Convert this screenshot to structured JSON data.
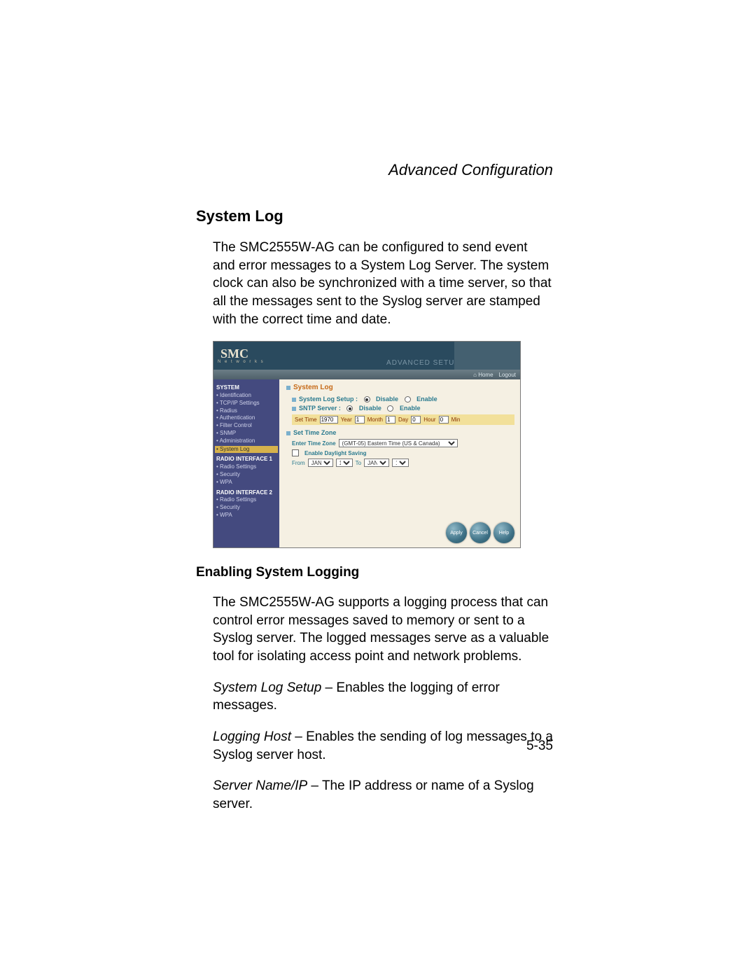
{
  "chapter_title": "Advanced Configuration",
  "section_title": "System Log",
  "intro_text": "The SMC2555W-AG can be configured to send event and error messages to a System Log Server. The system clock can also be synchronized with a time server, so that all the messages sent to the Syslog server are stamped with the correct time and date.",
  "subheading": "Enabling System Logging",
  "para1": "The SMC2555W-AG supports a logging process that can control error messages saved to memory or sent to a Syslog server. The logged messages serve as a valuable tool for isolating access point and network problems.",
  "def1_term": "System Log Setup",
  "def1_body": " – Enables the logging of error messages.",
  "def2_term": "Logging Host",
  "def2_body": " – Enables the sending of log messages to a Syslog server host.",
  "def3_term": "Server Name/IP",
  "def3_body": " – The IP address or name of a Syslog server.",
  "page_number": "5-35",
  "router": {
    "logo": "SMC",
    "logo_sub": "N e t w o r k s",
    "header_caption": "ADVANCED SETUP",
    "topbar": {
      "home": "Home",
      "logout": "Logout",
      "home_icon": "⌂"
    },
    "nav": {
      "grp_system": "SYSTEM",
      "identification": "Identification",
      "tcpip": "TCP/IP Settings",
      "radius": "Radius",
      "auth": "Authentication",
      "filter": "Filter Control",
      "snmp": "SNMP",
      "admin": "Administration",
      "syslog": "System Log",
      "grp_radio1": "RADIO INTERFACE 1",
      "radio_settings": "Radio Settings",
      "security": "Security",
      "wpa": "WPA",
      "grp_radio2": "RADIO INTERFACE 2"
    },
    "panel": {
      "title": "System Log",
      "syslog_setup_label": "System Log Setup :",
      "sntp_label": "SNTP Server :",
      "disable": "Disable",
      "enable": "Enable",
      "set_time_label": "Set Time",
      "year_val": "1970",
      "year_label": "Year",
      "month_val": "1",
      "month_label": "Month",
      "day_val": "1",
      "day_label": "Day",
      "hour_val": "0",
      "hour_label": "Hour",
      "min_val": "0",
      "min_label": "Min",
      "tz_section": "Set Time Zone",
      "tz_label": "Enter Time Zone",
      "tz_value": "(GMT-05) Eastern Time (US & Canada)",
      "daylight_label": "Enable Daylight Saving",
      "from_label": "From",
      "from_month": "JAN",
      "from_day": "1",
      "to_label": "To",
      "to_month": "JAN",
      "to_day": "1",
      "btn_apply": "Apply",
      "btn_cancel": "Cancel",
      "btn_help": "Help"
    }
  }
}
